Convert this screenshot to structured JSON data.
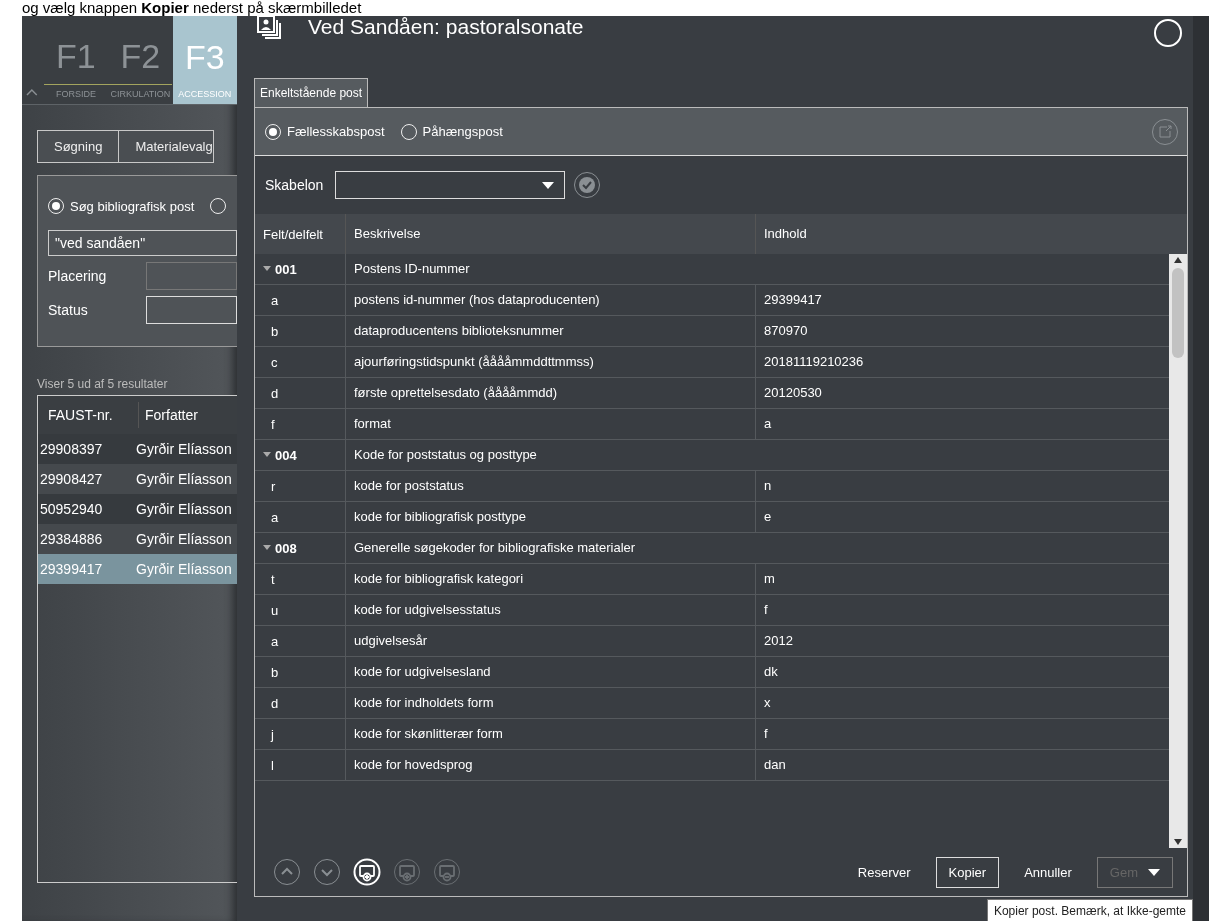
{
  "instruction": "og vælg knappen **Kopier** nederst på skærmbilledet",
  "app": {
    "function_keys": [
      {
        "key": "F1",
        "label": "FORSIDE",
        "selected": false
      },
      {
        "key": "F2",
        "label": "CIRKULATION",
        "selected": false
      },
      {
        "key": "F3",
        "label": "ACCESSION",
        "selected": true
      }
    ],
    "search_tabs": [
      "Søgning",
      "Materialevalg"
    ],
    "search_modes": [
      {
        "label": "Søg bibliografisk post",
        "selected": true
      },
      {
        "selected": false
      }
    ],
    "query": "\"ved sandåen\"",
    "filters": [
      {
        "label": "Placering",
        "disabled": true
      },
      {
        "label": "Status",
        "disabled": false
      }
    ],
    "result_count": "Viser 5 ud af 5 resultater",
    "results": {
      "columns": [
        "FAUST-nr.",
        "Forfatter"
      ],
      "rows": [
        {
          "faust": "29908397",
          "author": "Gyrðir Elíasson",
          "selected": false
        },
        {
          "faust": "29908427",
          "author": "Gyrðir Elíasson",
          "selected": false
        },
        {
          "faust": "50952940",
          "author": "Gyrðir Elíasson",
          "selected": false
        },
        {
          "faust": "29384886",
          "author": "Gyrðir Elíasson",
          "selected": false
        },
        {
          "faust": "29399417",
          "author": "Gyrðir Elíasson",
          "selected": true
        }
      ]
    }
  },
  "dialog": {
    "title": "Ved Sandåen: pastoralsonate",
    "tabs": [
      {
        "label": "Enkeltstående post"
      }
    ],
    "record_types": [
      {
        "label": "Fællesskabspost",
        "selected": true
      },
      {
        "label": "Påhængspost",
        "selected": false
      }
    ],
    "template": {
      "label": "Skabelon"
    },
    "table": {
      "columns": [
        "Felt/delfelt",
        "Beskrivelse",
        "Indhold"
      ],
      "fields": [
        {
          "code": "001",
          "description": "Postens ID-nummer",
          "expanded": true,
          "children": [
            {
              "code": "a",
              "description": "postens id-nummer (hos dataproducenten)",
              "content": "29399417"
            },
            {
              "code": "b",
              "description": "dataproducentens biblioteksnummer",
              "content": "870970"
            },
            {
              "code": "c",
              "description": "ajourføringstidspunkt (ååååmmddttmmss)",
              "content": "20181119210236"
            },
            {
              "code": "d",
              "description": "første oprettelsesdato (ååååmmdd)",
              "content": "20120530"
            },
            {
              "code": "f",
              "description": "format",
              "content": "a"
            }
          ]
        },
        {
          "code": "004",
          "description": "Kode for poststatus og posttype",
          "expanded": true,
          "children": [
            {
              "code": "r",
              "description": "kode for poststatus",
              "content": "n"
            },
            {
              "code": "a",
              "description": "kode for bibliografisk posttype",
              "content": "e"
            }
          ]
        },
        {
          "code": "008",
          "description": "Generelle søgekoder for bibliografiske materialer",
          "expanded": true,
          "children": [
            {
              "code": "t",
              "description": "kode for bibliografisk kategori",
              "content": "m"
            },
            {
              "code": "u",
              "description": "kode for udgivelsesstatus",
              "content": "f"
            },
            {
              "code": "a",
              "description": "udgivelsesår",
              "content": "2012"
            },
            {
              "code": "b",
              "description": "kode for udgivelsesland",
              "content": "dk"
            },
            {
              "code": "d",
              "description": "kode for indholdets form",
              "content": "x"
            },
            {
              "code": "j",
              "description": "kode for skønlitterær form",
              "content": "f"
            },
            {
              "code": "l",
              "description": "kode for hovedsprog",
              "content": "dan"
            }
          ]
        }
      ]
    },
    "tools": [
      {
        "kind": "up",
        "disabled": false
      },
      {
        "kind": "down",
        "disabled": false
      },
      {
        "kind": "add",
        "disabled": false
      },
      {
        "kind": "add-linked",
        "disabled": true
      },
      {
        "kind": "remove",
        "disabled": true
      }
    ],
    "buttons": [
      {
        "label": "Reserver",
        "outlined": false,
        "disabled": false,
        "dropdown": false
      },
      {
        "label": "Kopier",
        "outlined": true,
        "disabled": false,
        "dropdown": false
      },
      {
        "label": "Annuller",
        "outlined": false,
        "disabled": false,
        "dropdown": false
      },
      {
        "label": "Gem",
        "outlined": true,
        "disabled": true,
        "dropdown": true
      }
    ],
    "tooltip": "Kopier post. Bemærk, at Ikke-gemte"
  }
}
